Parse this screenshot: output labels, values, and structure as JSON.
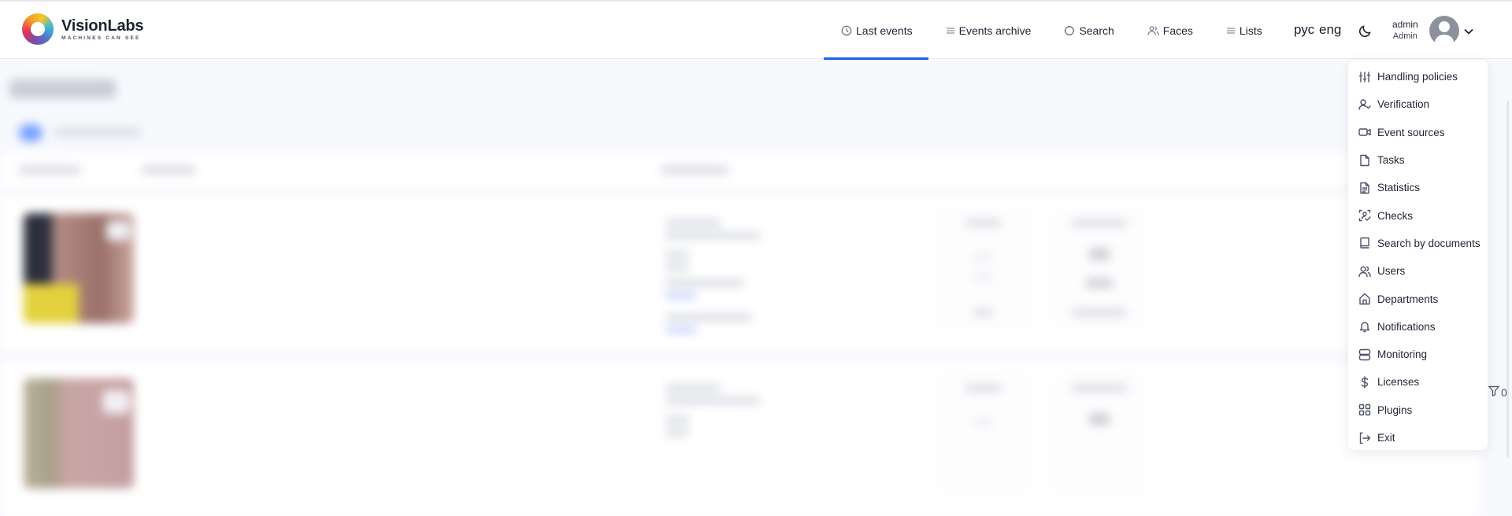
{
  "brand": {
    "name": "VisionLabs",
    "tagline": "MACHINES CAN SEE"
  },
  "nav": {
    "items": [
      {
        "label": "Last events",
        "icon": "clock-icon",
        "active": true
      },
      {
        "label": "Events archive",
        "icon": "list-icon",
        "active": false
      },
      {
        "label": "Search",
        "icon": "search-icon",
        "active": false
      },
      {
        "label": "Faces",
        "icon": "users-icon",
        "active": false
      },
      {
        "label": "Lists",
        "icon": "list-icon",
        "active": false
      }
    ],
    "accent_color": "#1a62e8"
  },
  "languages": {
    "ru": "рус",
    "en": "eng"
  },
  "user": {
    "login": "admin",
    "role": "Admin"
  },
  "user_menu": {
    "items": [
      {
        "label": "Handling policies",
        "icon": "sliders-icon"
      },
      {
        "label": "Verification",
        "icon": "user-check-icon"
      },
      {
        "label": "Event sources",
        "icon": "video-camera-icon"
      },
      {
        "label": "Tasks",
        "icon": "file-icon"
      },
      {
        "label": "Statistics",
        "icon": "file-text-icon"
      },
      {
        "label": "Checks",
        "icon": "face-scan-check-icon"
      },
      {
        "label": "Search by documents",
        "icon": "book-icon"
      },
      {
        "label": "Users",
        "icon": "users-icon"
      },
      {
        "label": "Departments",
        "icon": "home-icon"
      },
      {
        "label": "Notifications",
        "icon": "bell-icon"
      },
      {
        "label": "Monitoring",
        "icon": "server-icon"
      },
      {
        "label": "Licenses",
        "icon": "dollar-icon"
      },
      {
        "label": "Plugins",
        "icon": "grid-icon"
      },
      {
        "label": "Exit",
        "icon": "logout-icon"
      }
    ]
  },
  "filter": {
    "count": "0"
  }
}
